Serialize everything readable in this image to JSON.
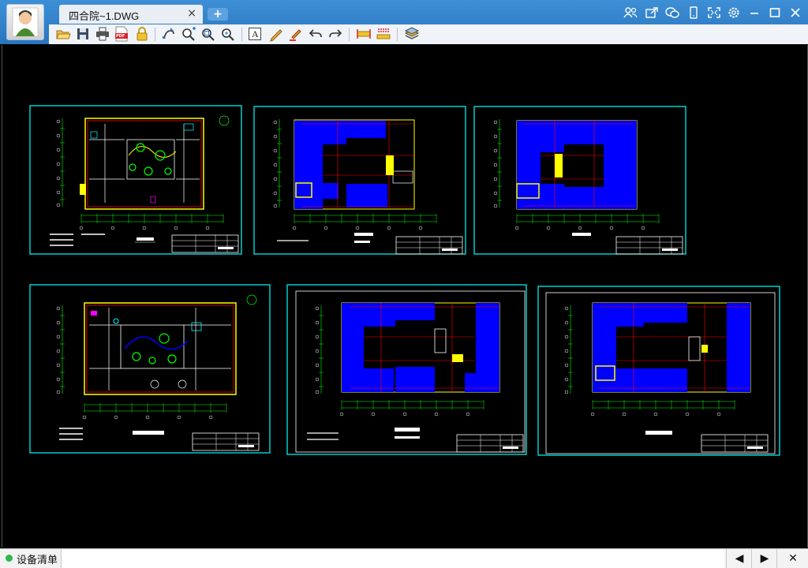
{
  "window": {
    "tab_title": "四合院~1.DWG",
    "tab_close": "×",
    "new_tab": "+"
  },
  "toolbar": {
    "pdf_badge": "PDF",
    "text_tool_label": "A"
  },
  "status": {
    "label": "设备清单",
    "prev": "◀",
    "next": "▶",
    "close": "✕"
  },
  "colors": {
    "title_bar": "#2f7fc8",
    "toolbar": "#f0f3f7",
    "frame": "#00ffff",
    "wall_blue": "#0000ff",
    "line_yellow": "#ffff00",
    "line_red": "#ff0000",
    "line_white": "#ffffff",
    "green": "#00ff00"
  },
  "icons": {
    "window": [
      "multi-user-icon",
      "share-icon",
      "wechat-icon",
      "mobile-icon",
      "fullscreen-icon",
      "settings-icon",
      "minimize-icon",
      "maximize-icon",
      "close-icon"
    ],
    "toolbar": [
      "open-folder-icon",
      "save-icon",
      "print-icon",
      "pdf-export-icon",
      "lock-icon",
      "pan-icon",
      "zoom-in-icon",
      "zoom-window-icon",
      "zoom-extents-icon",
      "text-icon",
      "pencil-icon",
      "highlighter-icon",
      "undo-icon",
      "redo-icon",
      "measure-icon",
      "measure-area-icon",
      "layers-icon"
    ]
  }
}
